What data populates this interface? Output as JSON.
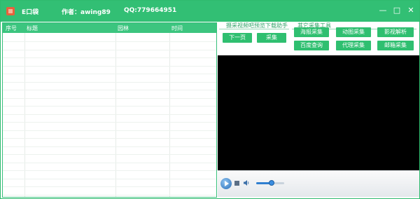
{
  "titlebar": {
    "app_title": "E口袋",
    "author": "作者：awing89",
    "qq": "QQ:779664951",
    "buttons": [
      "minimize-icon",
      "maximize-icon",
      "close-icon"
    ]
  },
  "list": {
    "columns": [
      "序号",
      "标题",
      "园林",
      "时间"
    ],
    "rows": []
  },
  "group1": {
    "title": "摄采视频吧预览下载助手",
    "next_page": "下一页",
    "collect": "采集"
  },
  "group2": {
    "title": "其它采集工具",
    "buttons": [
      "海报采集",
      "动图采集",
      "影视解析",
      "百度查询",
      "代理采集",
      "邮箱采集"
    ]
  },
  "player": {
    "volume": 0.55
  },
  "colors": {
    "accent": "#32bf74",
    "video_bg": "#000000"
  }
}
